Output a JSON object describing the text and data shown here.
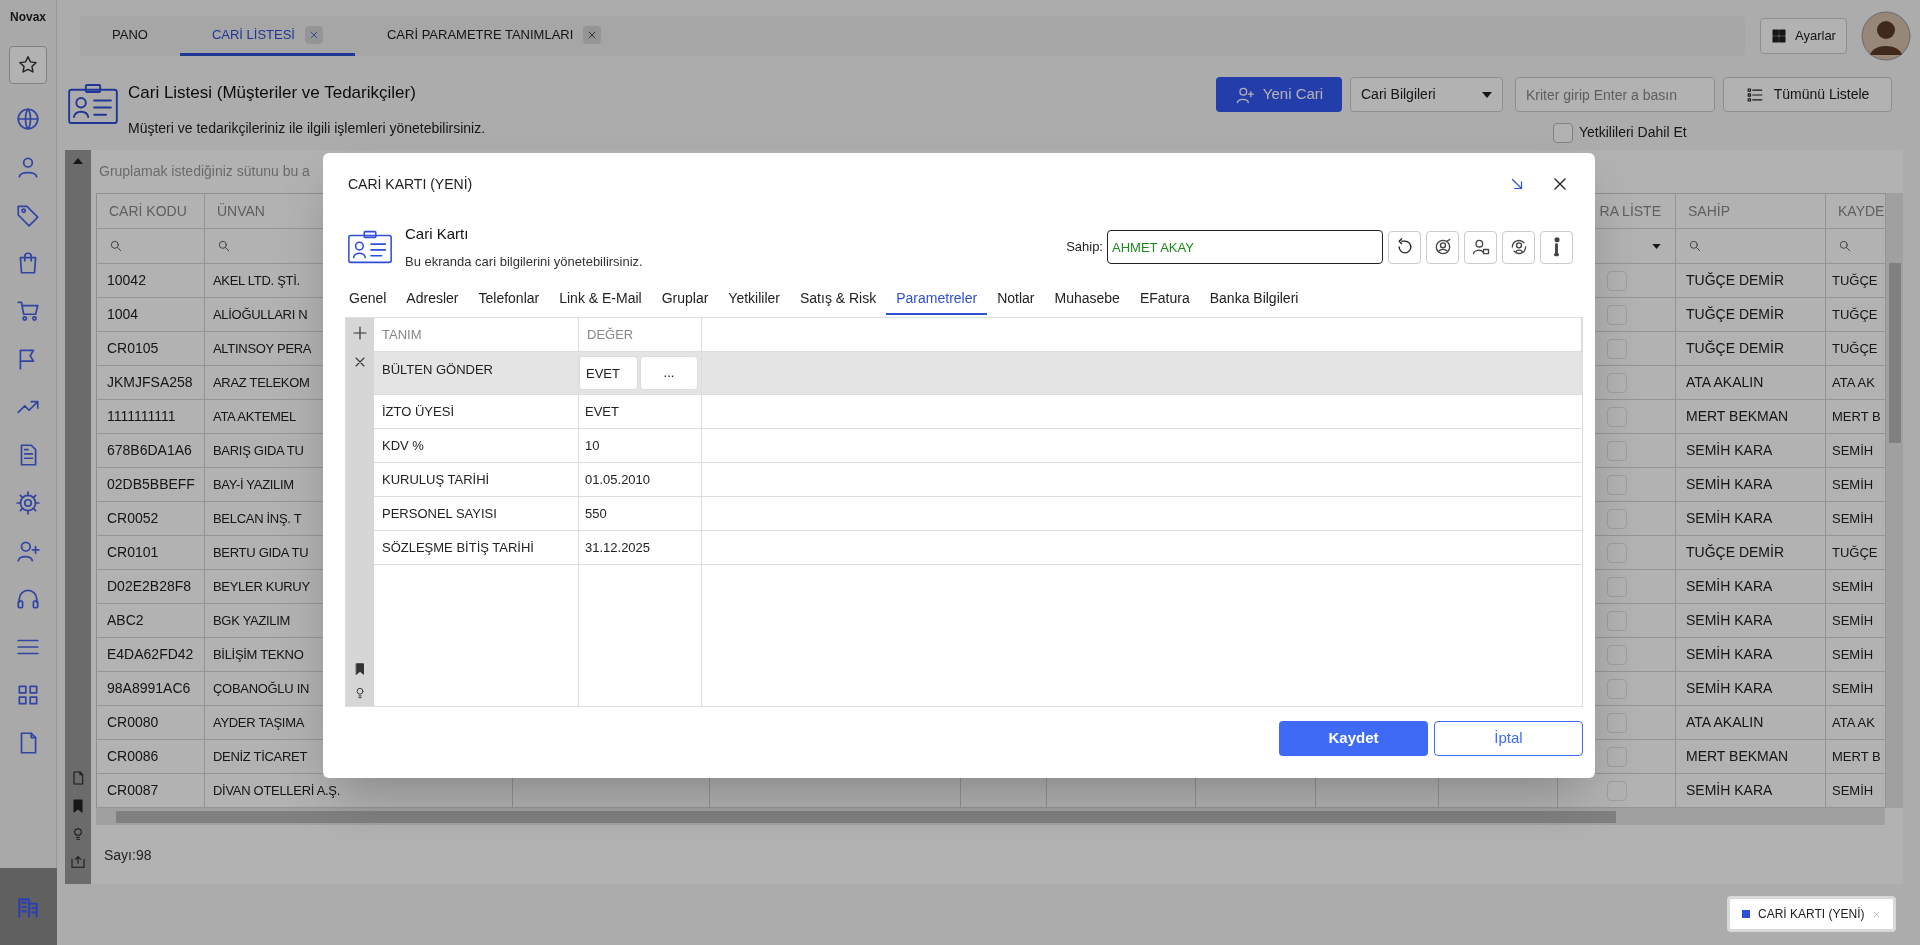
{
  "app": {
    "logo": "Novax"
  },
  "tabs": [
    {
      "label": "PANO",
      "selected": false,
      "closable": false
    },
    {
      "label": "CARİ LİSTESİ",
      "selected": true,
      "closable": true
    },
    {
      "label": "CARİ PARAMETRE TANIMLARI",
      "selected": false,
      "closable": true
    }
  ],
  "top_bar": {
    "settings_button": "Ayarlar"
  },
  "page_header": {
    "title": "Cari Listesi (Müşteriler ve Tedarikçiler)",
    "subtitle": "Müşteri ve tedarikçileriniz ile ilgili işlemleri yönetebilirsiniz."
  },
  "toolbar": {
    "new_button": "Yeni Cari",
    "dropdown": "Cari Bilgileri",
    "search": {
      "placeholder": "Kriter girip Enter a basın"
    },
    "list_all_button": "Tümünü Listele",
    "include_checkbox": {
      "label": "Yetkilileri Dahil Et",
      "checked": false
    }
  },
  "grid": {
    "group_panel_hint": "Gruplamak istediğiniz sütunu bu a",
    "columns": [
      "CARİ KODU",
      "ÜNVAN",
      "RA LİSTE",
      "SAHİP",
      "KAYDE"
    ],
    "rows": [
      {
        "code": "10042",
        "title": "AKEL LTD. ŞTİ.",
        "checked": false,
        "owner": "TUĞÇE DEMİR",
        "recorded_by": "TUĞÇE"
      },
      {
        "code": "1004",
        "title": "ALİOĞULLARI N",
        "checked": false,
        "owner": "TUĞÇE DEMİR",
        "recorded_by": "TUĞÇE"
      },
      {
        "code": "CR0105",
        "title": "ALTINSOY PERA",
        "checked": false,
        "owner": "TUĞÇE DEMİR",
        "recorded_by": "TUĞÇE"
      },
      {
        "code": "JKMJFSA258",
        "title": "ARAZ TELEKOM",
        "checked": false,
        "owner": "ATA AKALIN",
        "recorded_by": "ATA AK"
      },
      {
        "code": "1111111111",
        "title": "ATA AKTEMEL",
        "checked": false,
        "owner": "MERT BEKMAN",
        "recorded_by": "MERT B"
      },
      {
        "code": "678B6DA1A6",
        "title": "BARIŞ GIDA TU",
        "checked": false,
        "owner": "SEMİH KARA",
        "recorded_by": "SEMİH"
      },
      {
        "code": "02DB5BBEFF",
        "title": "BAY-İ YAZILIM",
        "checked": false,
        "owner": "SEMİH KARA",
        "recorded_by": "SEMİH"
      },
      {
        "code": "CR0052",
        "title": "BELCAN İNŞ. T",
        "checked": false,
        "owner": "SEMİH KARA",
        "recorded_by": "SEMİH"
      },
      {
        "code": "CR0101",
        "title": "BERTU GIDA TU",
        "checked": false,
        "owner": "TUĞÇE DEMİR",
        "recorded_by": "TUĞÇE"
      },
      {
        "code": "D02E2B28F8",
        "title": "BEYLER KURUY",
        "checked": false,
        "owner": "SEMİH KARA",
        "recorded_by": "SEMİH"
      },
      {
        "code": "ABC2",
        "title": "BGK YAZILIM",
        "checked": false,
        "owner": "SEMİH KARA",
        "recorded_by": "SEMİH"
      },
      {
        "code": "E4DA62FD42",
        "title": "BİLİŞİM TEKNO",
        "checked": false,
        "owner": "SEMİH KARA",
        "recorded_by": "SEMİH"
      },
      {
        "code": "98A8991AC6",
        "title": "ÇOBANOĞLU IN",
        "checked": false,
        "owner": "SEMİH KARA",
        "recorded_by": "SEMİH"
      },
      {
        "code": "CR0080",
        "title": "AYDER TAŞIMA",
        "checked": false,
        "owner": "ATA AKALIN",
        "recorded_by": "ATA AK"
      },
      {
        "code": "CR0086",
        "title": "DENİZ TİCARET",
        "checked": false,
        "owner": "MERT BEKMAN",
        "recorded_by": "MERT B"
      },
      {
        "code": "CR0087",
        "title": "DİVAN OTELLERİ A.Ş.",
        "checked": false,
        "owner": "SEMİH KARA",
        "recorded_by": "SEMİH"
      }
    ],
    "status": "Sayı:98"
  },
  "modal": {
    "title": "CARİ KARTI (YENİ)",
    "header": {
      "title": "Cari Kartı",
      "subtitle": "Bu ekranda cari bilgilerini yönetebilirsiniz."
    },
    "owner": {
      "label": "Sahip:",
      "value": "AHMET AKAY"
    },
    "tabs": [
      {
        "label": "Genel",
        "selected": false
      },
      {
        "label": "Adresler",
        "selected": false
      },
      {
        "label": "Telefonlar",
        "selected": false
      },
      {
        "label": "Link & E-Mail",
        "selected": false
      },
      {
        "label": "Gruplar",
        "selected": false
      },
      {
        "label": "Yetkililer",
        "selected": false
      },
      {
        "label": "Satış & Risk",
        "selected": false
      },
      {
        "label": "Parametreler",
        "selected": true
      },
      {
        "label": "Notlar",
        "selected": false
      },
      {
        "label": "Muhasebe",
        "selected": false
      },
      {
        "label": "EFatura",
        "selected": false
      },
      {
        "label": "Banka Bilgileri",
        "selected": false
      }
    ],
    "params": {
      "columns": [
        "TANIM",
        "DEĞER"
      ],
      "more_button": "...",
      "rows": [
        {
          "name": "BÜLTEN GÖNDER",
          "value": "EVET",
          "selected": true
        },
        {
          "name": "İZTO ÜYESİ",
          "value": "EVET",
          "selected": false
        },
        {
          "name": "KDV %",
          "value": "10",
          "selected": false
        },
        {
          "name": "KURULUŞ TARİHİ",
          "value": "01.05.2010",
          "selected": false
        },
        {
          "name": "PERSONEL SAYISI",
          "value": "550",
          "selected": false
        },
        {
          "name": "SÖZLEŞME BİTİŞ TARİHİ",
          "value": "31.12.2025",
          "selected": false
        }
      ]
    },
    "buttons": {
      "save": "Kaydet",
      "cancel": "İptal"
    }
  },
  "minimized": [
    {
      "label": "CARİ KARTI (YENİ)"
    }
  ]
}
